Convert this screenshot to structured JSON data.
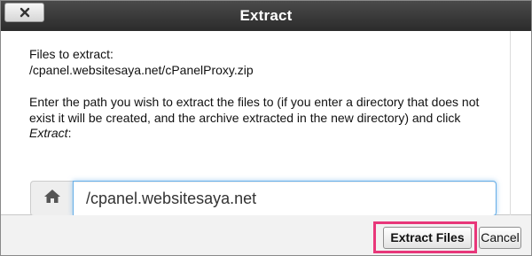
{
  "dialog": {
    "title": "Extract",
    "close_icon": "close-x-icon"
  },
  "content": {
    "files_label": "Files to extract:",
    "file_path": "/cpanel.websitesaya.net/cPanelProxy.zip",
    "instruction_prefix": "Enter the path you wish to extract the files to (if you enter a directory that does not exist it will be created, and the archive extracted in the new directory) and click ",
    "instruction_action": "Extract",
    "instruction_suffix": ":"
  },
  "path_field": {
    "addon_icon": "home-icon",
    "value": "/cpanel.websitesaya.net"
  },
  "footer": {
    "extract_label": "Extract Files",
    "cancel_label": "Cancel",
    "highlight_color": "#e8377a"
  }
}
